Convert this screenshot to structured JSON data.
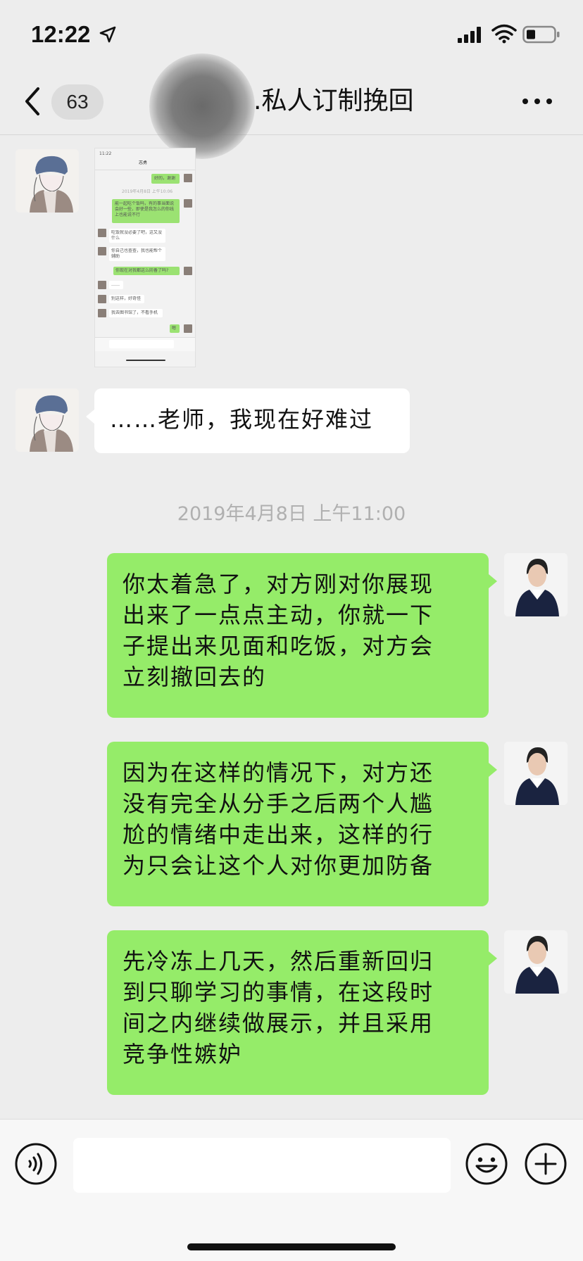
{
  "status_bar": {
    "time": "12:22",
    "icons": [
      "location-arrow-icon",
      "signal-icon",
      "wifi-icon",
      "battery-icon"
    ]
  },
  "nav": {
    "unread_count": "63",
    "title": ".私人订制挽回",
    "icons": [
      "back-chevron-icon",
      "more-dots-icon"
    ]
  },
  "messages": [
    {
      "side": "left",
      "type": "image",
      "content": "chat-screenshot",
      "thumb": {
        "time": "11:22",
        "title": "志勇",
        "date": "2019年4月8日 上午10:06",
        "lines": [
          "好的，谢谢",
          "能一起吃个饭吗，有的事当面说会好一些，即使是我怎么的你线上也能说不行",
          "吃饭就没必要了吧，这又没什么",
          "你自己也查查，我也能帮个辅助",
          "你现在对我都这么防备了吗?",
          "……",
          "别这样，好奇怪",
          "我去图书馆了，不看手机",
          "嗯"
        ]
      }
    },
    {
      "side": "left",
      "type": "text",
      "text": "……老师，我现在好难过"
    },
    {
      "side": "right",
      "type": "text",
      "lines": [
        "你太着急了，对方刚对你展现",
        "出来了一点点主动，你就一下",
        "子提出来见面和吃饭，对方会",
        "立刻撤回去的"
      ]
    },
    {
      "side": "right",
      "type": "text",
      "lines": [
        "因为在这样的情况下，对方还",
        "没有完全从分手之后两个人尴",
        "尬的情绪中走出来，这样的行",
        "为只会让这个人对你更加防备"
      ]
    },
    {
      "side": "right",
      "type": "text",
      "lines": [
        "先冷冻上几天，然后重新回归",
        "到只聊学习的事情，在这段时",
        "间之内继续做展示，并且采用",
        "竞争性嫉妒"
      ]
    }
  ],
  "timestamp": "2019年4月8日 上午11:00",
  "input_bar": {
    "value": "",
    "icons": [
      "voice-icon",
      "emoji-icon",
      "plus-icon"
    ]
  },
  "colors": {
    "background": "#ededed",
    "bubble_sent": "#95ec69",
    "bubble_received": "#ffffff"
  }
}
